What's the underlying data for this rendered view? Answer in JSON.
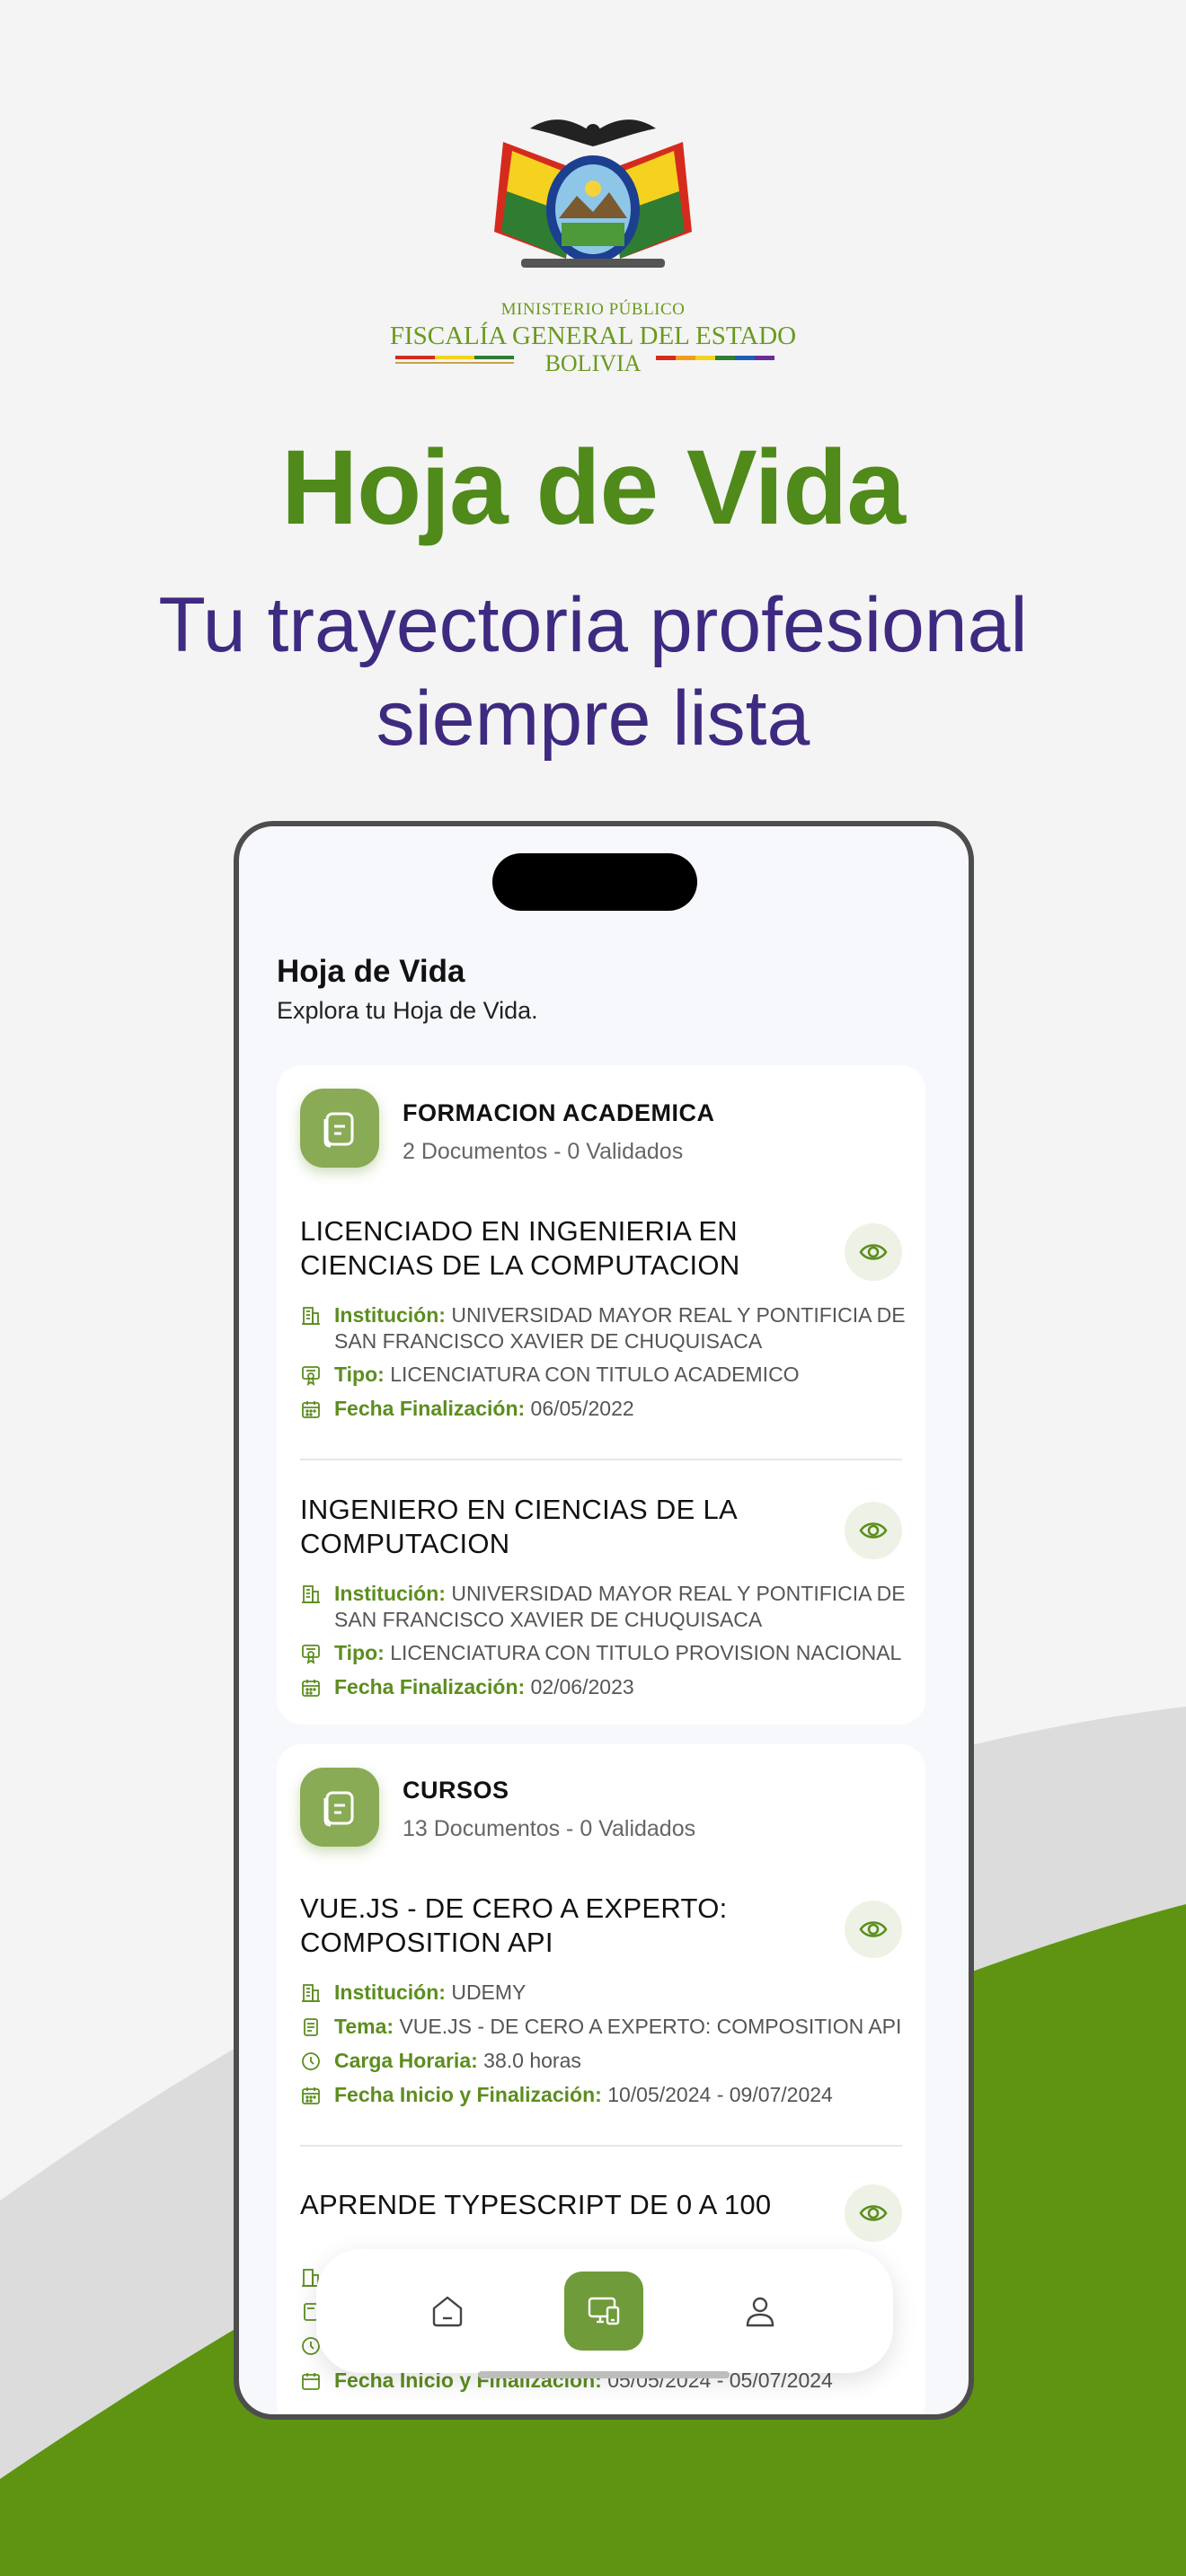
{
  "logo": {
    "line1": "MINISTERIO PÚBLICO",
    "line2": "FISCALÍA GENERAL DEL ESTADO",
    "line3": "BOLIVIA"
  },
  "hero": {
    "title": "Hoja de Vida",
    "subtitle_line1": "Tu trayectoria profesional",
    "subtitle_line2": "siempre lista"
  },
  "app": {
    "title": "Hoja de Vida",
    "subtitle": "Explora tu Hoja de Vida."
  },
  "sections": [
    {
      "title": "FORMACION ACADEMICA",
      "count": "2 Documentos - 0 Validados",
      "items": [
        {
          "title_line1": "LICENCIADO EN INGENIERIA EN",
          "title_line2": "CIENCIAS DE LA COMPUTACION",
          "inst_label": "Institución:",
          "inst_value": "UNIVERSIDAD MAYOR REAL Y PONTIFICIA DE SAN FRANCISCO XAVIER DE CHUQUISACA",
          "tipo_label": "Tipo:",
          "tipo_value": "LICENCIATURA CON TITULO ACADEMICO",
          "fecha_label": "Fecha Finalización:",
          "fecha_value": "06/05/2022"
        },
        {
          "title_line1": "INGENIERO EN CIENCIAS DE LA",
          "title_line2": "COMPUTACION",
          "inst_label": "Institución:",
          "inst_value": "UNIVERSIDAD MAYOR REAL Y PONTIFICIA DE SAN FRANCISCO XAVIER DE CHUQUISACA",
          "tipo_label": "Tipo:",
          "tipo_value": "LICENCIATURA CON TITULO PROVISION NACIONAL",
          "fecha_label": "Fecha Finalización:",
          "fecha_value": "02/06/2023"
        }
      ]
    },
    {
      "title": "CURSOS",
      "count": "13 Documentos - 0 Validados",
      "items": [
        {
          "title_line1": "VUE.JS - DE CERO A EXPERTO:",
          "title_line2": "COMPOSITION API",
          "inst_label": "Institución:",
          "inst_value": "UDEMY",
          "tema_label": "Tema:",
          "tema_value": "VUE.JS - DE CERO A EXPERTO: COMPOSITION API",
          "carga_label": "Carga Horaria:",
          "carga_value": "38.0 horas",
          "fecha_label": "Fecha Inicio y Finalización:",
          "fecha_value": "10/05/2024 - 09/07/2024"
        },
        {
          "title_line1": "APRENDE TYPESCRIPT DE 0 A 100",
          "fecha_label": "Fecha Inicio y Finalización:",
          "fecha_value": "05/05/2024 - 05/07/2024"
        }
      ]
    }
  ],
  "icons": {
    "section": "document-icon",
    "view": "eye-icon",
    "institution": "building-icon",
    "tipo": "certificate-icon",
    "tema": "note-icon",
    "carga": "clock-icon",
    "fecha": "calendar-icon"
  },
  "nav": {
    "items": [
      "home-icon",
      "devices-icon",
      "user-icon"
    ],
    "active_index": 1
  },
  "colors": {
    "green": "#5c8d1f",
    "purple": "#3e2a80",
    "nav_active": "#6f9b3a"
  }
}
